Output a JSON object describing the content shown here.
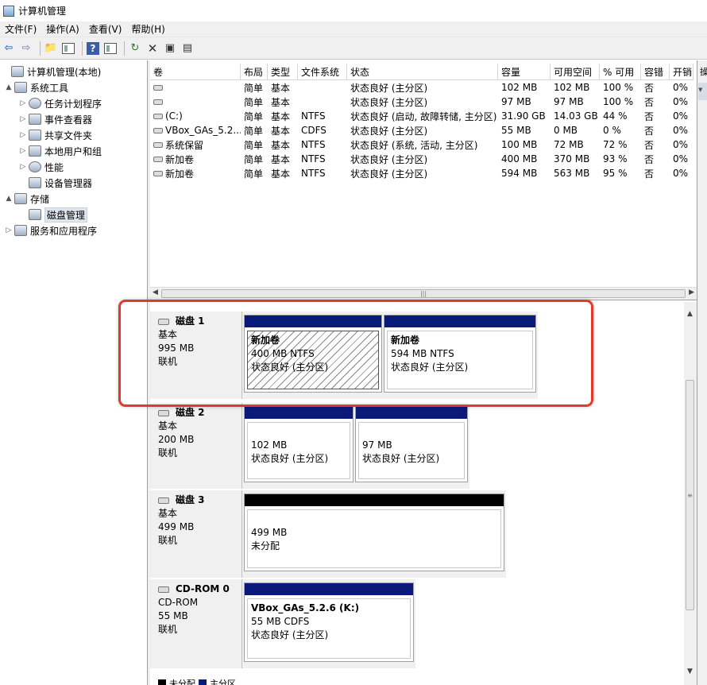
{
  "window": {
    "title": "计算机管理"
  },
  "menu": [
    "文件(F)",
    "操作(A)",
    "查看(V)",
    "帮助(H)"
  ],
  "toolbar": {
    "icons": [
      "back-icon",
      "forward-icon",
      "up-folder-icon",
      "show-tree-icon",
      "help-icon",
      "panel-icon",
      "refresh-icon",
      "delete-icon",
      "properties-icon",
      "export-icon"
    ]
  },
  "tree": [
    {
      "label": "计算机管理(本地)",
      "level": 0,
      "expand": "",
      "icon": "computer-management-icon"
    },
    {
      "label": "系统工具",
      "level": 1,
      "expand": "▲",
      "icon": "tools-icon"
    },
    {
      "label": "任务计划程序",
      "level": 2,
      "expand": "▷",
      "icon": "clock-icon"
    },
    {
      "label": "事件查看器",
      "level": 2,
      "expand": "▷",
      "icon": "event-viewer-icon"
    },
    {
      "label": "共享文件夹",
      "level": 2,
      "expand": "▷",
      "icon": "shared-folder-icon"
    },
    {
      "label": "本地用户和组",
      "level": 2,
      "expand": "▷",
      "icon": "users-icon"
    },
    {
      "label": "性能",
      "level": 2,
      "expand": "▷",
      "icon": "performance-icon"
    },
    {
      "label": "设备管理器",
      "level": 2,
      "expand": "",
      "icon": "device-manager-icon"
    },
    {
      "label": "存储",
      "level": 1,
      "expand": "▲",
      "icon": "storage-icon"
    },
    {
      "label": "磁盘管理",
      "level": 2,
      "expand": "",
      "icon": "disk-management-icon",
      "selected": true
    },
    {
      "label": "服务和应用程序",
      "level": 1,
      "expand": "▷",
      "icon": "services-icon"
    }
  ],
  "volumes": {
    "headers": [
      "卷",
      "布局",
      "类型",
      "文件系统",
      "状态",
      "容量",
      "可用空间",
      "% 可用",
      "容错",
      "开销"
    ],
    "rows": [
      [
        "",
        "简单",
        "基本",
        "",
        "状态良好 (主分区)",
        "102 MB",
        "102 MB",
        "100 %",
        "否",
        "0%"
      ],
      [
        "",
        "简单",
        "基本",
        "",
        "状态良好 (主分区)",
        "97 MB",
        "97 MB",
        "100 %",
        "否",
        "0%"
      ],
      [
        "(C:)",
        "简单",
        "基本",
        "NTFS",
        "状态良好 (启动, 故障转储, 主分区)",
        "31.90 GB",
        "14.03 GB",
        "44 %",
        "否",
        "0%"
      ],
      [
        "VBox_GAs_5.2....",
        "简单",
        "基本",
        "CDFS",
        "状态良好 (主分区)",
        "55 MB",
        "0 MB",
        "0 %",
        "否",
        "0%"
      ],
      [
        "系统保留",
        "简单",
        "基本",
        "NTFS",
        "状态良好 (系统, 活动, 主分区)",
        "100 MB",
        "72 MB",
        "72 %",
        "否",
        "0%"
      ],
      [
        "新加卷",
        "简单",
        "基本",
        "NTFS",
        "状态良好 (主分区)",
        "400 MB",
        "370 MB",
        "93 %",
        "否",
        "0%"
      ],
      [
        "新加卷",
        "简单",
        "基本",
        "NTFS",
        "状态良好 (主分区)",
        "594 MB",
        "563 MB",
        "95 %",
        "否",
        "0%"
      ]
    ]
  },
  "action_pane": {
    "header": "操",
    "glyph": "▼"
  },
  "disks": [
    {
      "name": "磁盘 1",
      "type": "基本",
      "size": "995 MB",
      "status": "联机",
      "parts": [
        {
          "title": "新加卷",
          "size": "400 MB NTFS",
          "status": "状态良好 (主分区)",
          "selected": true
        },
        {
          "title": "新加卷",
          "size": "594 MB NTFS",
          "status": "状态良好 (主分区)"
        }
      ]
    },
    {
      "name": "磁盘 2",
      "type": "基本",
      "size": "200 MB",
      "status": "联机",
      "parts": [
        {
          "title": "",
          "size": "102 MB",
          "status": "状态良好 (主分区)"
        },
        {
          "title": "",
          "size": "97 MB",
          "status": "状态良好 (主分区)"
        }
      ]
    },
    {
      "name": "磁盘 3",
      "type": "基本",
      "size": "499 MB",
      "status": "联机",
      "parts": [
        {
          "title": "",
          "size": "499 MB",
          "status": "未分配",
          "unallocated": true
        }
      ]
    },
    {
      "name": "CD-ROM 0",
      "type": "CD-ROM",
      "size": "55 MB",
      "status": "联机",
      "parts": [
        {
          "title": "VBox_GAs_5.2.6  (K:)",
          "size": "55 MB CDFS",
          "status": "状态良好 (主分区)"
        }
      ]
    }
  ],
  "legend": [
    {
      "label": "未分配",
      "color": "#000000"
    },
    {
      "label": "主分区",
      "color": "#0a1a7a"
    }
  ],
  "colors": {
    "partition_bar": "#0a1a7a",
    "unallocated_bar": "#000000",
    "highlight": "#e03a2a"
  }
}
